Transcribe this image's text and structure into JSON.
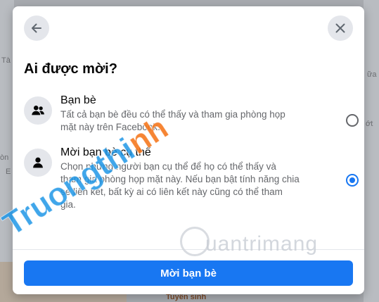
{
  "background": {
    "texts": [
      "Tà",
      "òn",
      "E",
      "ữa",
      "ớt",
      "Tuyển sinh"
    ]
  },
  "dialog": {
    "title": "Ai được mời?",
    "back_label": "Back",
    "close_label": "Close",
    "options": [
      {
        "title": "Bạn bè",
        "description": "Tất cả bạn bè đều có thể thấy và tham gia phòng họp mặt này trên Facebook.",
        "selected": false
      },
      {
        "title": "Mời bạn bè cụ thể",
        "description": "Chọn những người bạn cụ thể để họ có thể thấy và tham gia phòng họp mặt này. Nếu bạn bật tính năng chia sẻ liên kết, bất kỳ ai có liên kết này cũng có thể tham gia.",
        "selected": true
      }
    ],
    "primary_button": "Mời bạn bè"
  },
  "watermark": {
    "site": "uantrimang",
    "diagonal_blue": "Truongthi",
    "diagonal_orange": "nh"
  },
  "colors": {
    "accent": "#1877f2",
    "icon_bg": "#e4e6eb",
    "secondary_text": "#65676b"
  }
}
